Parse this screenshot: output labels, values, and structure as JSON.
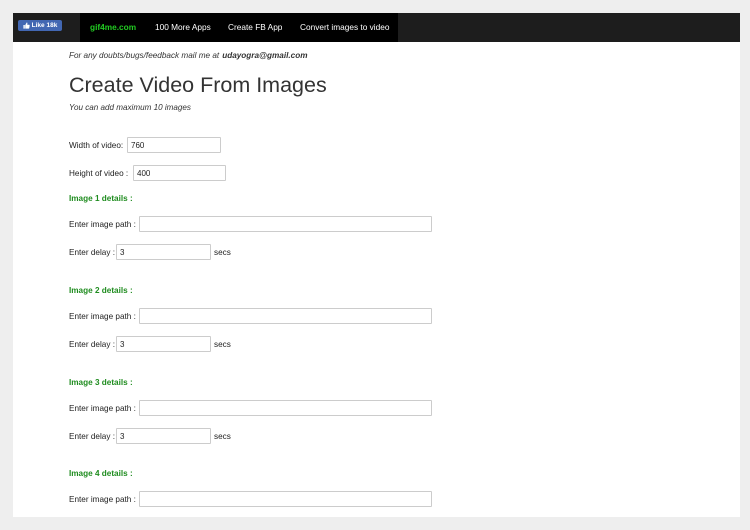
{
  "topbar": {
    "like_button": {
      "label": "Like 18k",
      "icon": "thumbs-up-icon"
    },
    "brand": "gif4me.com",
    "nav": [
      {
        "label": "100 More Apps"
      },
      {
        "label": "Create FB App"
      },
      {
        "label": "Convert images to video"
      }
    ]
  },
  "notice": {
    "text": "For any doubts/bugs/feedback mail me at",
    "email": "udayogra@gmail.com"
  },
  "page_title": "Create Video From Images",
  "subtitle": "You can add maximum 10 images",
  "video_size": {
    "width": {
      "label": "Width of video:",
      "value": "760"
    },
    "height": {
      "label": "Height of video :",
      "value": "400"
    }
  },
  "images": [
    {
      "heading": "Image 1 details :",
      "path_label": "Enter image path :",
      "path_value": "",
      "delay_label": "Enter delay :",
      "delay_value": "3",
      "delay_unit": "secs"
    },
    {
      "heading": "Image 2 details :",
      "path_label": "Enter image path :",
      "path_value": "",
      "delay_label": "Enter delay :",
      "delay_value": "3",
      "delay_unit": "secs"
    },
    {
      "heading": "Image 3 details :",
      "path_label": "Enter image path :",
      "path_value": "",
      "delay_label": "Enter delay :",
      "delay_value": "3",
      "delay_unit": "secs"
    },
    {
      "heading": "Image 4 details :",
      "path_label": "Enter image path :",
      "path_value": ""
    }
  ],
  "colors": {
    "page_background": "#eeeeee",
    "topbar": "#1d1d1d",
    "nav": "#000000",
    "brand": "#22cc22",
    "section_heading": "#1f8c1f",
    "like_button": "#4267b2"
  }
}
